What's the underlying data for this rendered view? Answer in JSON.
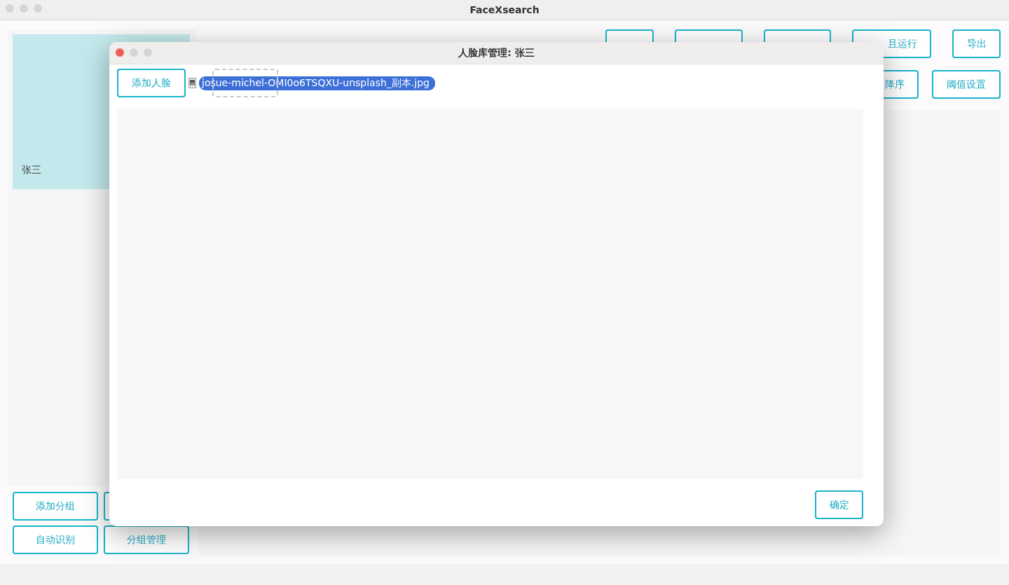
{
  "window": {
    "title": "FaceXsearch"
  },
  "groups": [
    {
      "name": "张三",
      "selected": true
    }
  ],
  "left_buttons": [
    "添加分组",
    "自动识别",
    "分组管理"
  ],
  "toolbar_row1": [
    "且运行",
    "导出"
  ],
  "toolbar_row2": [
    "降序",
    "阈值设置"
  ],
  "dialog": {
    "title": "人脸库管理: 张三",
    "add_button": "添加人脸",
    "dragged_file": {
      "name": "josue-michel-OMI0o6TSQXU-unsplash_副本.jpg",
      "selected": true
    },
    "confirm_button": "确定"
  }
}
